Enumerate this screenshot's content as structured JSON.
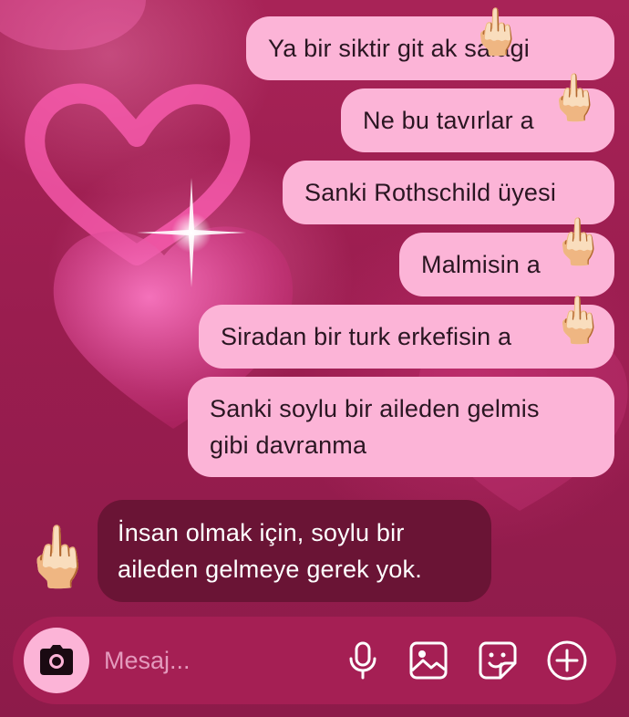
{
  "conversation": {
    "outgoing": [
      {
        "text": "Ya bir siktir git a",
        "tail": "k salagi"
      },
      {
        "text": "Ne bu tavırlar a"
      },
      {
        "text": "Sanki Rothschild üyesi"
      },
      {
        "text": "Malmisin a"
      },
      {
        "text": "Siradan bir turk erkefisin a"
      },
      {
        "line1": "Sanki soylu bir aileden gelmis",
        "line2": "gibi davranma"
      }
    ],
    "incoming": {
      "line1": "İnsan olmak için, soylu bir",
      "line2": "aileden gelmeye gerek yok."
    },
    "reaction_emoji": "🖕🏻"
  },
  "composer": {
    "placeholder": "Mesaj...",
    "icons": [
      "camera-icon",
      "microphone-icon",
      "image-icon",
      "sticker-icon",
      "add-icon"
    ]
  },
  "colors": {
    "background": "#9a1e4e",
    "outgoing_bubble": "#fcb4d7",
    "incoming_bubble": "#6a1435",
    "composer_bar": "#a51f54"
  }
}
